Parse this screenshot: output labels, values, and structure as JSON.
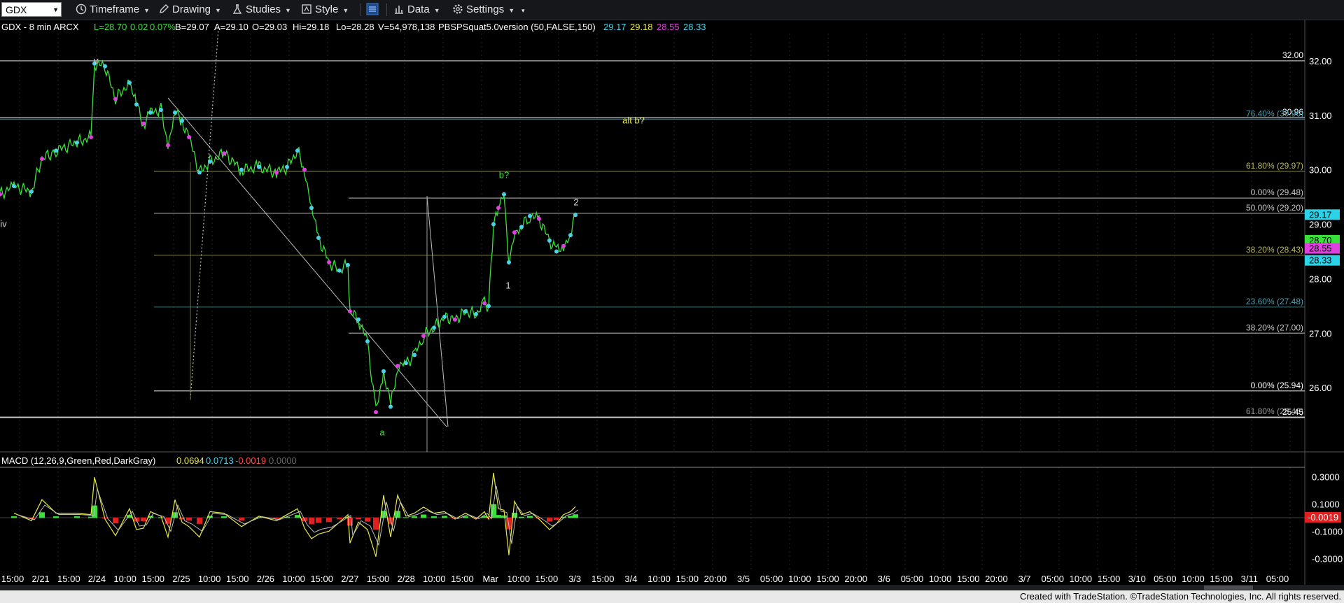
{
  "toolbar": {
    "symbol": "GDX",
    "timeframe_label": "Timeframe",
    "drawing_label": "Drawing",
    "studies_label": "Studies",
    "style_label": "Style",
    "data_label": "Data",
    "settings_label": "Settings"
  },
  "header": {
    "prefix": "GDX - 8 min  ARCX",
    "last": "L=28.70",
    "change": "0.02",
    "change_pct": "0.07%",
    "bid": "B=29.07",
    "ask": "A=29.10",
    "open": "O=29.03",
    "high": "Hi=29.18",
    "low": "Lo=28.28",
    "volume": "V=54,978,138",
    "study": "PBSPSquat5.0version (50,FALSE,150)",
    "study_values": [
      "29.17",
      "29.18",
      "28.55",
      "28.33"
    ],
    "study_colors": [
      "#4ad3e8",
      "#e8e84a",
      "#e040e0",
      "#4ad3e8"
    ]
  },
  "macd_header": {
    "label": "MACD (12,26,9,Green,Red,DarkGray)",
    "values": [
      "0.0694",
      "0.0713",
      "-0.0019",
      "0.0000"
    ],
    "colors": [
      "#e8e84a",
      "#4ad3e8",
      "#ff4a4a",
      "#666666"
    ]
  },
  "chart_data": {
    "type": "line",
    "price_axis": {
      "ticks": [
        "32.00",
        "31.00",
        "30.00",
        "29.00",
        "28.00",
        "27.00",
        "26.00"
      ],
      "ylim": [
        25.0,
        32.5
      ]
    },
    "price_tags": [
      {
        "label": "29.17",
        "value": 29.17,
        "bg": "#2ad3e8",
        "fg": "#000000"
      },
      {
        "label": "28.70",
        "value": 28.7,
        "bg": "#3ae03a",
        "fg": "#000000"
      },
      {
        "label": "28.55",
        "value": 28.55,
        "bg": "#e040e0",
        "fg": "#000000"
      },
      {
        "label": "28.33",
        "value": 28.33,
        "bg": "#2ad3e8",
        "fg": "#000000"
      }
    ],
    "x_labels": [
      "15:00",
      "2/21",
      "15:00",
      "2/24",
      "10:00",
      "15:00",
      "2/25",
      "10:00",
      "15:00",
      "2/26",
      "10:00",
      "15:00",
      "2/27",
      "15:00",
      "2/28",
      "10:00",
      "15:00",
      "Mar",
      "10:00",
      "15:00",
      "3/3",
      "15:00",
      "3/4",
      "10:00",
      "15:00",
      "20:00",
      "3/5",
      "05:00",
      "10:00",
      "15:00",
      "20:00",
      "3/6",
      "05:00",
      "10:00",
      "15:00",
      "20:00",
      "3/7",
      "05:00",
      "10:00",
      "15:00",
      "3/10",
      "05:00",
      "10:00",
      "15:00",
      "3/11",
      "05:00"
    ],
    "levels": [
      {
        "value": 32.0,
        "label": "32.00",
        "x0": 0,
        "color": "#d0d0d0",
        "text_color": "#ffffff"
      },
      {
        "value": 30.96,
        "label": "30.96",
        "x0": 0,
        "color": "#d0d0d0",
        "text_color": "#ffffff"
      },
      {
        "value": 30.93,
        "label": "76.40% (30.96)",
        "x0": 0,
        "color": "#4a7a86",
        "text_color": "#4aa0b0"
      },
      {
        "value": 29.97,
        "label": "61.80% (29.97)",
        "x0": 220,
        "color": "#6e6e3a",
        "text_color": "#b8b85a"
      },
      {
        "value": 29.48,
        "label": "0.00% (29.48)",
        "x0": 498,
        "color": "#9a9a9a",
        "text_color": "#c8c8c8"
      },
      {
        "value": 29.2,
        "label": "50.00% (29.20)",
        "x0": 220,
        "color": "#9a9a9a",
        "text_color": "#c8c8c8"
      },
      {
        "value": 28.43,
        "label": "38.20% (28.43)",
        "x0": 220,
        "color": "#6e6e3a",
        "text_color": "#b8b85a"
      },
      {
        "value": 27.48,
        "label": "23.60% (27.48)",
        "x0": 220,
        "color": "#2f5a62",
        "text_color": "#4aa0b0"
      },
      {
        "value": 27.0,
        "label": "38.20% (27.00)",
        "x0": 498,
        "color": "#9a9a9a",
        "text_color": "#c8c8c8"
      },
      {
        "value": 25.94,
        "label": "0.00% (25.94)",
        "x0": 220,
        "color": "#d0d0d0",
        "text_color": "#ffffff"
      },
      {
        "value": 25.46,
        "label": "61.80% (25.46)",
        "x0": 0,
        "color": "#d0d0d0",
        "text_color": "#9a9a9a"
      },
      {
        "value": 25.45,
        "label": "25.45",
        "x0": 0,
        "color": "#d0d0d0",
        "text_color": "#ffffff"
      }
    ],
    "annotations": [
      {
        "text": "v",
        "x": 137,
        "price": 31.95,
        "color": "#d8d8d8"
      },
      {
        "text": "iv",
        "x": 5,
        "price": 28.95,
        "color": "#d8d8d8"
      },
      {
        "text": "alt b?",
        "x": 905,
        "price": 30.85,
        "color": "#e8e84a"
      },
      {
        "text": "b?",
        "x": 720,
        "price": 29.85,
        "color": "#3ae03a"
      },
      {
        "text": "2",
        "x": 823,
        "price": 29.35,
        "color": "#d8d8d8"
      },
      {
        "text": "1",
        "x": 726,
        "price": 27.82,
        "color": "#d8d8d8"
      },
      {
        "text": "a",
        "x": 546,
        "price": 25.12,
        "color": "#3ae03a"
      }
    ],
    "series": [
      {
        "x": [
          0,
          20,
          45,
          60,
          80,
          110,
          130,
          135,
          150,
          165,
          185,
          195,
          205,
          215,
          230,
          240,
          250,
          260,
          270,
          285,
          300,
          320,
          345,
          370,
          395,
          410,
          425,
          435,
          445,
          455,
          470,
          485,
          497,
          500,
          512,
          525,
          537,
          548,
          558,
          568,
          580,
          592,
          605,
          620,
          635,
          650,
          665,
          680,
          692,
          698,
          705,
          712,
          720,
          727,
          735,
          745,
          757,
          770,
          785,
          795,
          805,
          815,
          822
        ],
        "y": [
          29.55,
          29.7,
          29.6,
          30.2,
          30.35,
          30.5,
          30.6,
          31.95,
          31.9,
          31.3,
          31.6,
          31.2,
          30.85,
          31.05,
          31.1,
          30.45,
          31.05,
          30.9,
          30.6,
          29.95,
          30.15,
          30.3,
          30.0,
          30.05,
          29.95,
          30.05,
          30.35,
          30.0,
          29.3,
          28.75,
          28.3,
          28.15,
          28.25,
          27.4,
          27.25,
          26.85,
          25.55,
          26.3,
          25.65,
          26.4,
          26.45,
          26.6,
          26.95,
          27.1,
          27.3,
          27.25,
          27.4,
          27.35,
          27.55,
          27.5,
          29.0,
          29.3,
          29.55,
          28.3,
          28.85,
          28.95,
          29.15,
          29.1,
          28.7,
          28.5,
          28.6,
          28.8,
          29.17
        ]
      }
    ],
    "macd": {
      "ticks": [
        "0.3000",
        "0.1000",
        "-0.1000",
        "-0.3000"
      ],
      "ylim": [
        -0.37,
        0.37
      ],
      "zero": 0.0,
      "current_label": "-0.0019"
    }
  }
}
